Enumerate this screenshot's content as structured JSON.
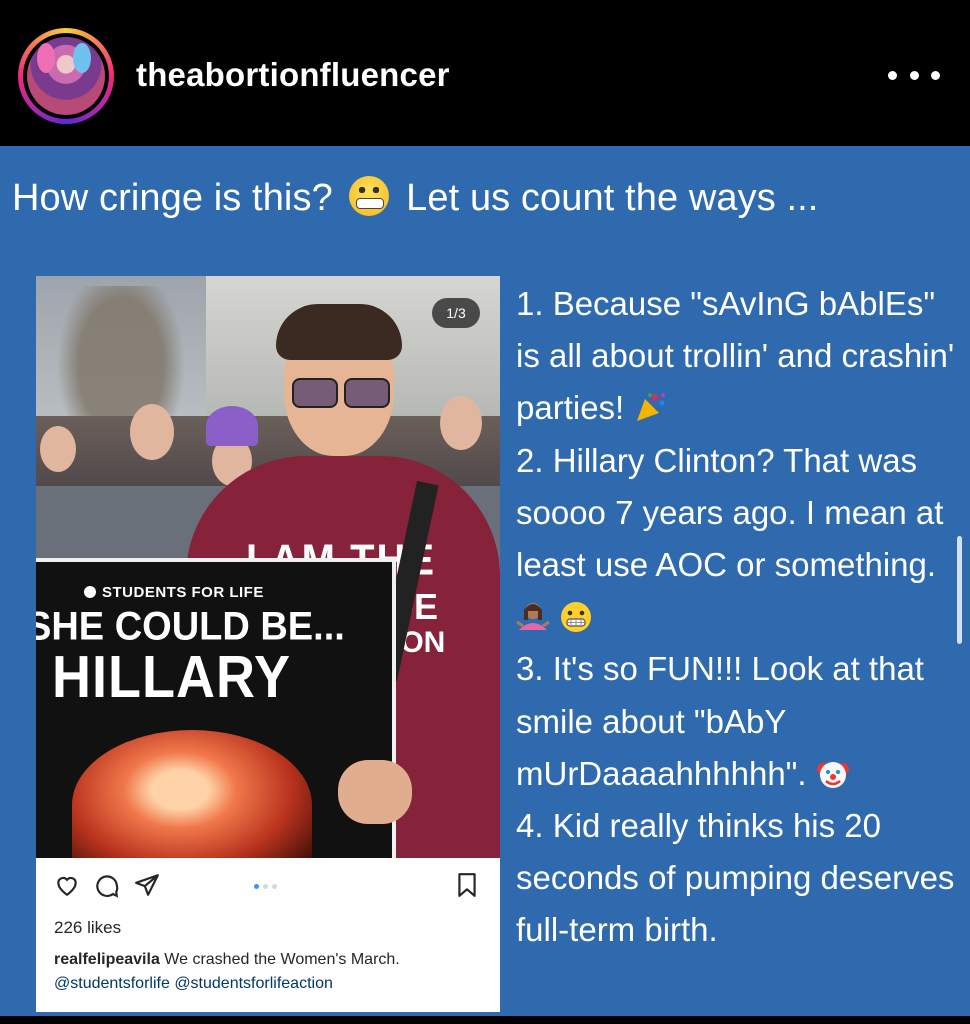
{
  "header": {
    "username": "theabortionfluencer",
    "more_label": "More options"
  },
  "post": {
    "headline_part1": "How cringe is this?",
    "headline_part2": "Let us count the ways ...",
    "embedded": {
      "counter": "1/3",
      "sign": {
        "org": "STUDENTS FOR LIFE",
        "line1": "SHE COULD BE...",
        "line2": "HILLARY"
      },
      "hoodie_text_1": "I AM THE",
      "hoodie_text_2": "FE",
      "hoodie_text_3": "ION",
      "likes": "226 likes",
      "caption_user": "realfelipeavila",
      "caption_text": "We crashed the Women's March.",
      "mention_1": "@studentsforlife",
      "mention_2": "@studentsforlifeaction"
    },
    "list": {
      "item1_line": "1. Because \"sAvInG bAblEs\" is all about trollin' and crashin' parties!",
      "item2_line": "2. Hillary Clinton? That was soooo 7 years ago. I mean at least use AOC or something.",
      "item3_line": "3. It's so FUN!!! Look at that smile about \"bAbY mUrDaaaahhhhhh\".",
      "item4_line": "4. Kid really thinks his 20 seconds of pumping deserves full-term birth."
    }
  },
  "icons": [
    "more-icon",
    "grimace-icon",
    "party-popper-icon",
    "woman-shrugging-icon",
    "clown-icon",
    "heart-icon",
    "comment-icon",
    "share-icon",
    "bookmark-icon"
  ],
  "colors": {
    "post_background": "#2f6aae",
    "header_background": "#000000",
    "text": "#ffffff"
  }
}
